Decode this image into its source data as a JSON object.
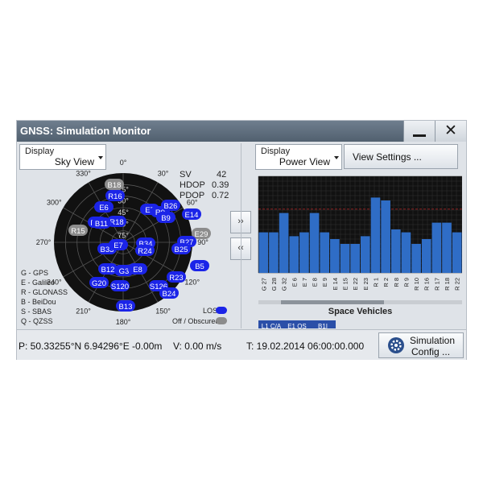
{
  "window": {
    "title": "GNSS: Simulation Monitor",
    "minimize_icon": "minimize-icon",
    "close_icon": "close-icon",
    "close_glyph": "✕"
  },
  "left_panel": {
    "display_caption": "Display",
    "display_value": "Sky View",
    "stats": {
      "sv_label": "SV",
      "sv_value": "42",
      "hdop_label": "HDOP",
      "hdop_value": "0.39",
      "pdop_label": "PDOP",
      "pdop_value": "0.72"
    },
    "constellation_legend": [
      "G - GPS",
      "E - Galileo",
      "R - GLONASS",
      "B - BeiDou",
      "S - SBAS",
      "Q - QZSS"
    ],
    "los_label": "LOS",
    "obscured_label": "Off / Obscured",
    "azimuth_labels": [
      "0°",
      "30°",
      "60°",
      "90°",
      "120°",
      "150°",
      "180°",
      "210°",
      "240°",
      "270°",
      "300°",
      "330°"
    ],
    "elevation_labels": [
      "15°",
      "30°",
      "45°",
      "60°",
      "75°"
    ],
    "satellites": [
      {
        "id": "B18",
        "state": "obscured"
      },
      {
        "id": "R16",
        "state": "los"
      },
      {
        "id": "E7",
        "state": "los"
      },
      {
        "id": "R9",
        "state": "los"
      },
      {
        "id": "B26",
        "state": "los"
      },
      {
        "id": "E6",
        "state": "los"
      },
      {
        "id": "R10",
        "state": "los"
      },
      {
        "id": "R18",
        "state": "los"
      },
      {
        "id": "B11",
        "state": "los"
      },
      {
        "id": "B9",
        "state": "los"
      },
      {
        "id": "E14",
        "state": "los"
      },
      {
        "id": "R15",
        "state": "obscured"
      },
      {
        "id": "E29",
        "state": "obscured"
      },
      {
        "id": "B33",
        "state": "los"
      },
      {
        "id": "E7",
        "state": "los"
      },
      {
        "id": "B34",
        "state": "los"
      },
      {
        "id": "R24",
        "state": "los"
      },
      {
        "id": "B27",
        "state": "los"
      },
      {
        "id": "B25",
        "state": "los"
      },
      {
        "id": "B5",
        "state": "los"
      },
      {
        "id": "B12",
        "state": "los"
      },
      {
        "id": "G3",
        "state": "los"
      },
      {
        "id": "E8",
        "state": "los"
      },
      {
        "id": "R23",
        "state": "los"
      },
      {
        "id": "G20",
        "state": "los"
      },
      {
        "id": "S120",
        "state": "los"
      },
      {
        "id": "S126",
        "state": "los"
      },
      {
        "id": "B24",
        "state": "los"
      },
      {
        "id": "B13",
        "state": "los"
      }
    ]
  },
  "right_panel": {
    "display_caption": "Display",
    "display_value": "Power View",
    "view_settings_label": "View Settings ...",
    "x_axis_label": "Space Vehicles",
    "legend": [
      "L1 C/A",
      "E1 OS",
      "B1I"
    ]
  },
  "nav": {
    "right_label": "››",
    "left_label": "‹‹"
  },
  "status": {
    "position": "P: 50.33255°N 6.94296°E -0.00m",
    "velocity": "V: 0.00 m/s",
    "time": "T: 19.02.2014 06:00:00.000",
    "sim_config_line1": "Simulation",
    "sim_config_line2": "Config ...",
    "gear_icon": "gear-icon"
  },
  "colors": {
    "sat_los": "#1b24e8",
    "sat_obscured": "#8c8c8c",
    "bar": "#2f6dc6",
    "chart_bg": "#111111",
    "titlebar": "#5f6e7e"
  },
  "chart_data": {
    "type": "bar",
    "title": "",
    "xlabel": "Space Vehicles",
    "ylabel": "",
    "categories": [
      "G 27",
      "G 28",
      "G 32",
      "E 6",
      "E 7",
      "E 8",
      "E 9",
      "E 14",
      "E 15",
      "E 22",
      "E 23",
      "R 1",
      "R 2",
      "R 8",
      "R 9",
      "R 10",
      "R 16",
      "R 17",
      "R 18",
      "R 22"
    ],
    "values": [
      0.42,
      0.42,
      0.62,
      0.38,
      0.42,
      0.62,
      0.42,
      0.35,
      0.3,
      0.3,
      0.38,
      0.78,
      0.75,
      0.45,
      0.42,
      0.3,
      0.35,
      0.52,
      0.52,
      0.42
    ],
    "ylim": [
      0,
      1
    ],
    "grid": true,
    "legend": "bottom-left"
  }
}
